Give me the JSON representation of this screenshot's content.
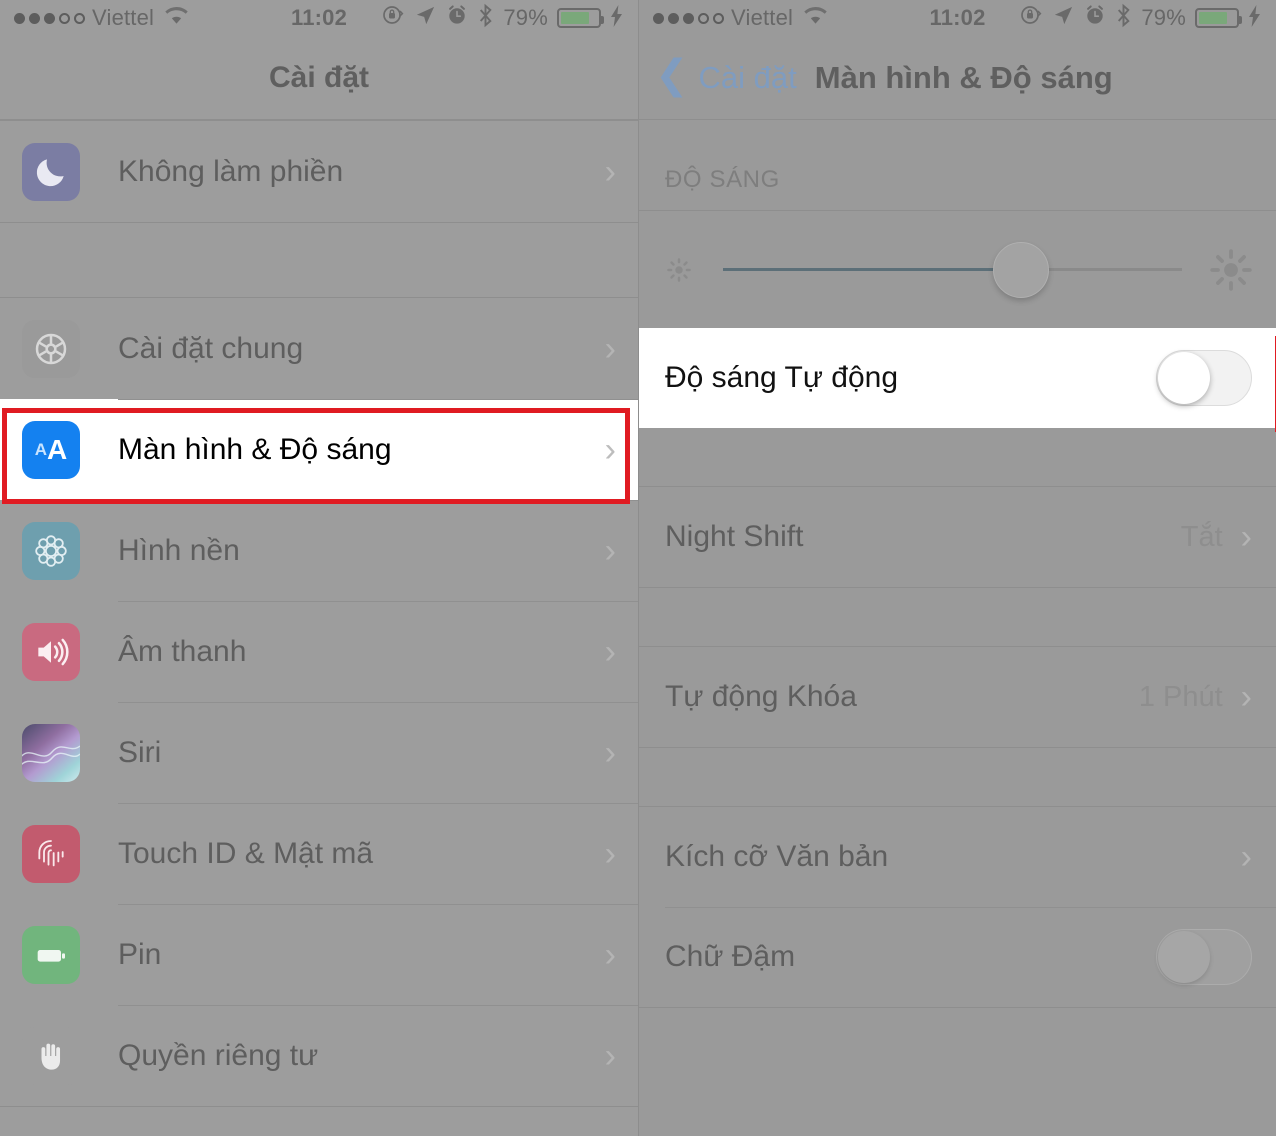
{
  "status_bar": {
    "signal_dots_filled": 3,
    "signal_dots_total": 5,
    "carrier": "Viettel",
    "time": "11:02",
    "battery_percent": "79%",
    "battery_level": 79,
    "icons": [
      "rotation-lock-icon",
      "location-arrow-icon",
      "alarm-clock-icon",
      "bluetooth-icon",
      "battery-icon",
      "charging-bolt-icon"
    ]
  },
  "left_panel": {
    "title": "Cài đặt",
    "groups": [
      {
        "rows": [
          {
            "label": "Không làm phiền",
            "icon": "moon-icon",
            "icon_color": "#7b7da3",
            "chevron": "›"
          }
        ]
      },
      {
        "rows": [
          {
            "label": "Cài đặt chung",
            "icon": "gear-icon",
            "icon_color": "#9a9a9a",
            "chevron": "›"
          },
          {
            "label": "Màn hình & Độ sáng",
            "icon": "aa-display-icon",
            "icon_color": "#1481f0",
            "icon_text": "AA",
            "chevron": "›",
            "highlighted": true
          },
          {
            "label": "Hình nền",
            "icon": "wallpaper-flower-icon",
            "icon_color": "#6e9fae",
            "chevron": "›"
          },
          {
            "label": "Âm thanh",
            "icon": "speaker-icon",
            "icon_color": "#c96a80",
            "chevron": "›"
          },
          {
            "label": "Siri",
            "icon": "siri-waveform-icon",
            "icon_color": "#6f6f8e",
            "chevron": "›"
          },
          {
            "label": "Touch ID & Mật mã",
            "icon": "fingerprint-icon",
            "icon_color": "#c25b6e",
            "chevron": "›"
          },
          {
            "label": "Pin",
            "icon": "battery-icon",
            "icon_color": "#71b57d",
            "chevron": "›"
          },
          {
            "label": "Quyền riêng tư",
            "icon": "hand-privacy-icon",
            "icon_color": "#9d9d9d",
            "chevron": "›"
          }
        ]
      }
    ]
  },
  "right_panel": {
    "back_label": "Cài đặt",
    "title": "Màn hình & Độ sáng",
    "section_header": "ĐỘ SÁNG",
    "slider": {
      "name": "brightness-slider",
      "value_percent": 65,
      "min_icon": "sun-small-icon",
      "max_icon": "sun-large-icon"
    },
    "rows": [
      {
        "label": "Độ sáng Tự động",
        "control": "toggle",
        "toggle_on": false,
        "highlighted": true
      },
      {
        "label": "Night Shift",
        "value": "Tắt",
        "chevron": "›"
      },
      {
        "label": "Tự động Khóa",
        "value": "1 Phút",
        "chevron": "›"
      },
      {
        "label": "Kích cỡ Văn bản",
        "value": "",
        "chevron": "›"
      },
      {
        "label": "Chữ Đậm",
        "control": "toggle",
        "toggle_on": false
      }
    ]
  },
  "colors": {
    "highlight_red": "#e01b22",
    "accent_blue": "#1481f0",
    "nav_link_blue": "#7f9cc0",
    "dim_background": "#9a9a9a"
  }
}
